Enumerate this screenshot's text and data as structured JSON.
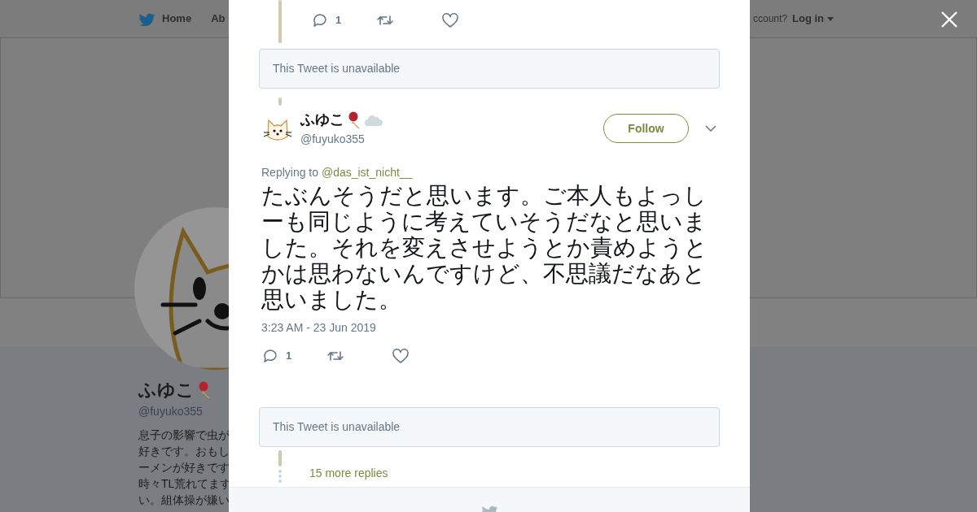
{
  "nav": {
    "items": [
      {
        "label": "Home"
      },
      {
        "label": "Ab"
      }
    ],
    "account_prompt": "ccount?",
    "login": "Log in"
  },
  "profile": {
    "name": "ふゆこ",
    "handle": "@fuyuko355",
    "bio_lines": [
      "息子の影響で虫が",
      "好きです。おもし",
      "ーメンが好きです",
      "時々TL荒れてます",
      "い。組体操が嫌い"
    ]
  },
  "modal": {
    "parent_actions": {
      "reply_count": "1"
    },
    "thread": [
      {
        "kind": "unavailable",
        "text": "This Tweet is unavailable"
      },
      {
        "kind": "tweet",
        "name": "ふゆこ",
        "handle": "@fuyuko355",
        "follow_label": "Follow",
        "replying_label": "Replying to",
        "replying_handle": "@das_ist_nicht__",
        "text": "たぶんそうだと思います。ご本人もよっしーも同じように考えていそうだなと思いました。それを変えさせようとか責めようとかは思わないんですけど、不思議だなあと思いました。",
        "timestamp": "3:23 AM - 23 Jun 2019",
        "reply_count": "1"
      },
      {
        "kind": "unavailable",
        "text": "This Tweet is unavailable"
      },
      {
        "kind": "more",
        "text": "15 more replies"
      }
    ]
  }
}
